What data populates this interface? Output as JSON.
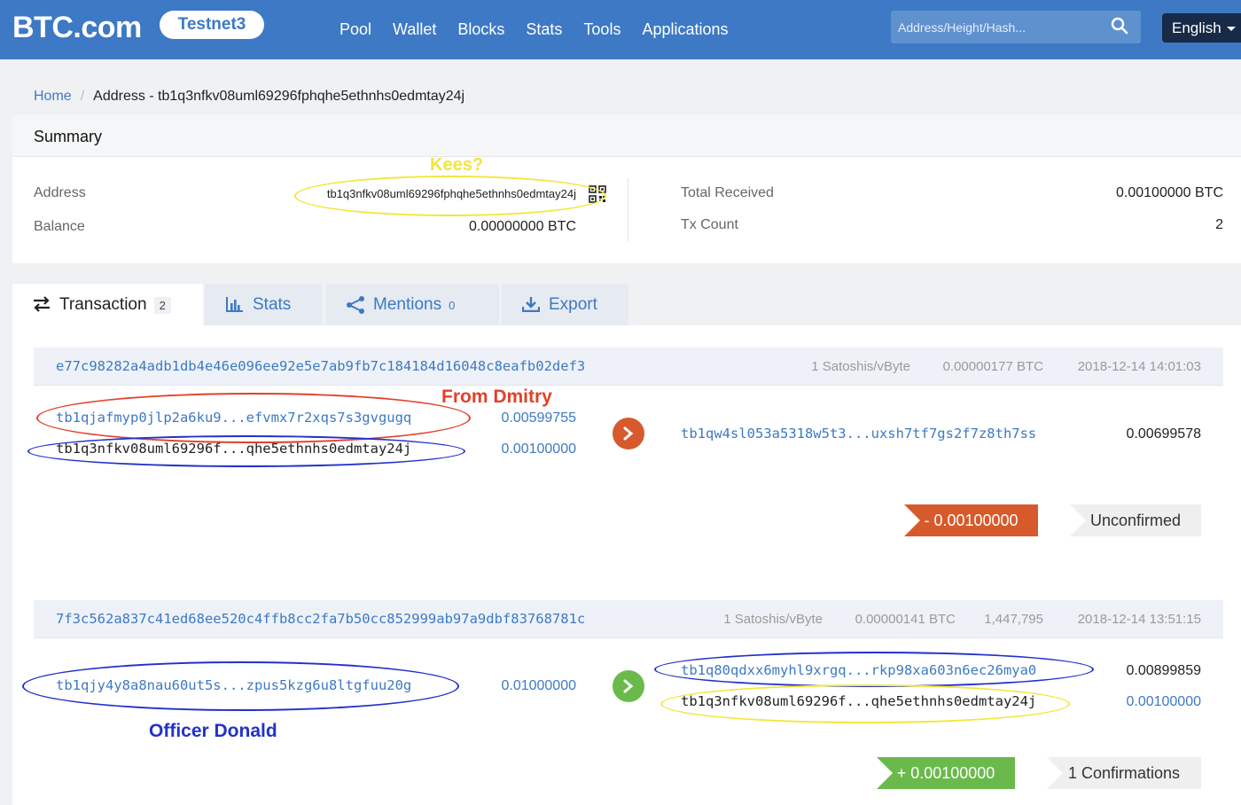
{
  "brand": {
    "logo": "BTC.com",
    "network": "Testnet3"
  },
  "nav": [
    "Pool",
    "Wallet",
    "Blocks",
    "Stats",
    "Tools",
    "Applications"
  ],
  "search": {
    "placeholder": "Address/Height/Hash..."
  },
  "language": "English",
  "breadcrumb": {
    "home": "Home",
    "current": "Address - tb1q3nfkv08uml69296fphqhe5ethnhs0edmtay24j"
  },
  "summary": {
    "title": "Summary",
    "address_label": "Address",
    "address_value": "tb1q3nfkv08uml69296fphqhe5ethnhs0edmtay24j",
    "balance_label": "Balance",
    "balance_value": "0.00000000 BTC",
    "total_received_label": "Total Received",
    "total_received_value": "0.00100000 BTC",
    "tx_count_label": "Tx Count",
    "tx_count_value": "2"
  },
  "tabs": [
    {
      "label": "Transaction",
      "count": "2",
      "icon": "swap-icon"
    },
    {
      "label": "Stats",
      "count": "",
      "icon": "bar-chart-icon"
    },
    {
      "label": "Mentions",
      "count": "0",
      "icon": "share-icon"
    },
    {
      "label": "Export",
      "count": "",
      "icon": "download-icon"
    }
  ],
  "transactions": [
    {
      "hash": "e77c98282a4adb1db4e46e096ee92e5e7ab9fb7c184184d16048c8eafb02def3",
      "fee_rate": "1 Satoshis/vByte",
      "fee": "0.00000177 BTC",
      "confirmations_height": "",
      "time": "2018-12-14 14:01:03",
      "inputs": [
        {
          "address": "tb1qjafmyp0jlp2a6ku9...efvmx7r2xqs7s3gvgugq",
          "amount": "0.00599755"
        },
        {
          "address": "tb1q3nfkv08uml69296f...qhe5ethnhs0edmtay24j",
          "amount": "0.00100000"
        }
      ],
      "outputs": [
        {
          "address": "tb1qw4sl053a5318w5t3...uxsh7tf7gs2f7z8th7ss",
          "amount": "0.00699578"
        }
      ],
      "change": "- 0.00100000",
      "status": "Unconfirmed"
    },
    {
      "hash": "7f3c562a837c41ed68ee520c4ffb8cc2fa7b50cc852999ab97a9dbf83768781c",
      "fee_rate": "1 Satoshis/vByte",
      "fee": "0.00000141 BTC",
      "confirmations_height": "1,447,795",
      "time": "2018-12-14 13:51:15",
      "inputs": [
        {
          "address": "tb1qjy4y8a8nau60ut5s...zpus5kzg6u8ltgfuu20g",
          "amount": "0.01000000"
        }
      ],
      "outputs": [
        {
          "address": "tb1q80qdxx6myhl9xrgq...rkp98xa603n6ec26mya0",
          "amount": "0.00899859"
        },
        {
          "address": "tb1q3nfkv08uml69296f...qhe5ethnhs0edmtay24j",
          "amount": "0.00100000"
        }
      ],
      "change": "+ 0.00100000",
      "status": "1 Confirmations"
    }
  ],
  "annotations": {
    "kees": "Kees?",
    "from_dmitry": "From Dmitry",
    "officer_donald": "Officer Donald"
  },
  "colors": {
    "navbar": "#3d79c5",
    "link": "#3d79c5",
    "negative": "#d65a2c",
    "positive": "#6aba4b",
    "annotation_yellow": "#f2e63a",
    "annotation_red": "#e2412a",
    "annotation_blue": "#2231c9"
  }
}
